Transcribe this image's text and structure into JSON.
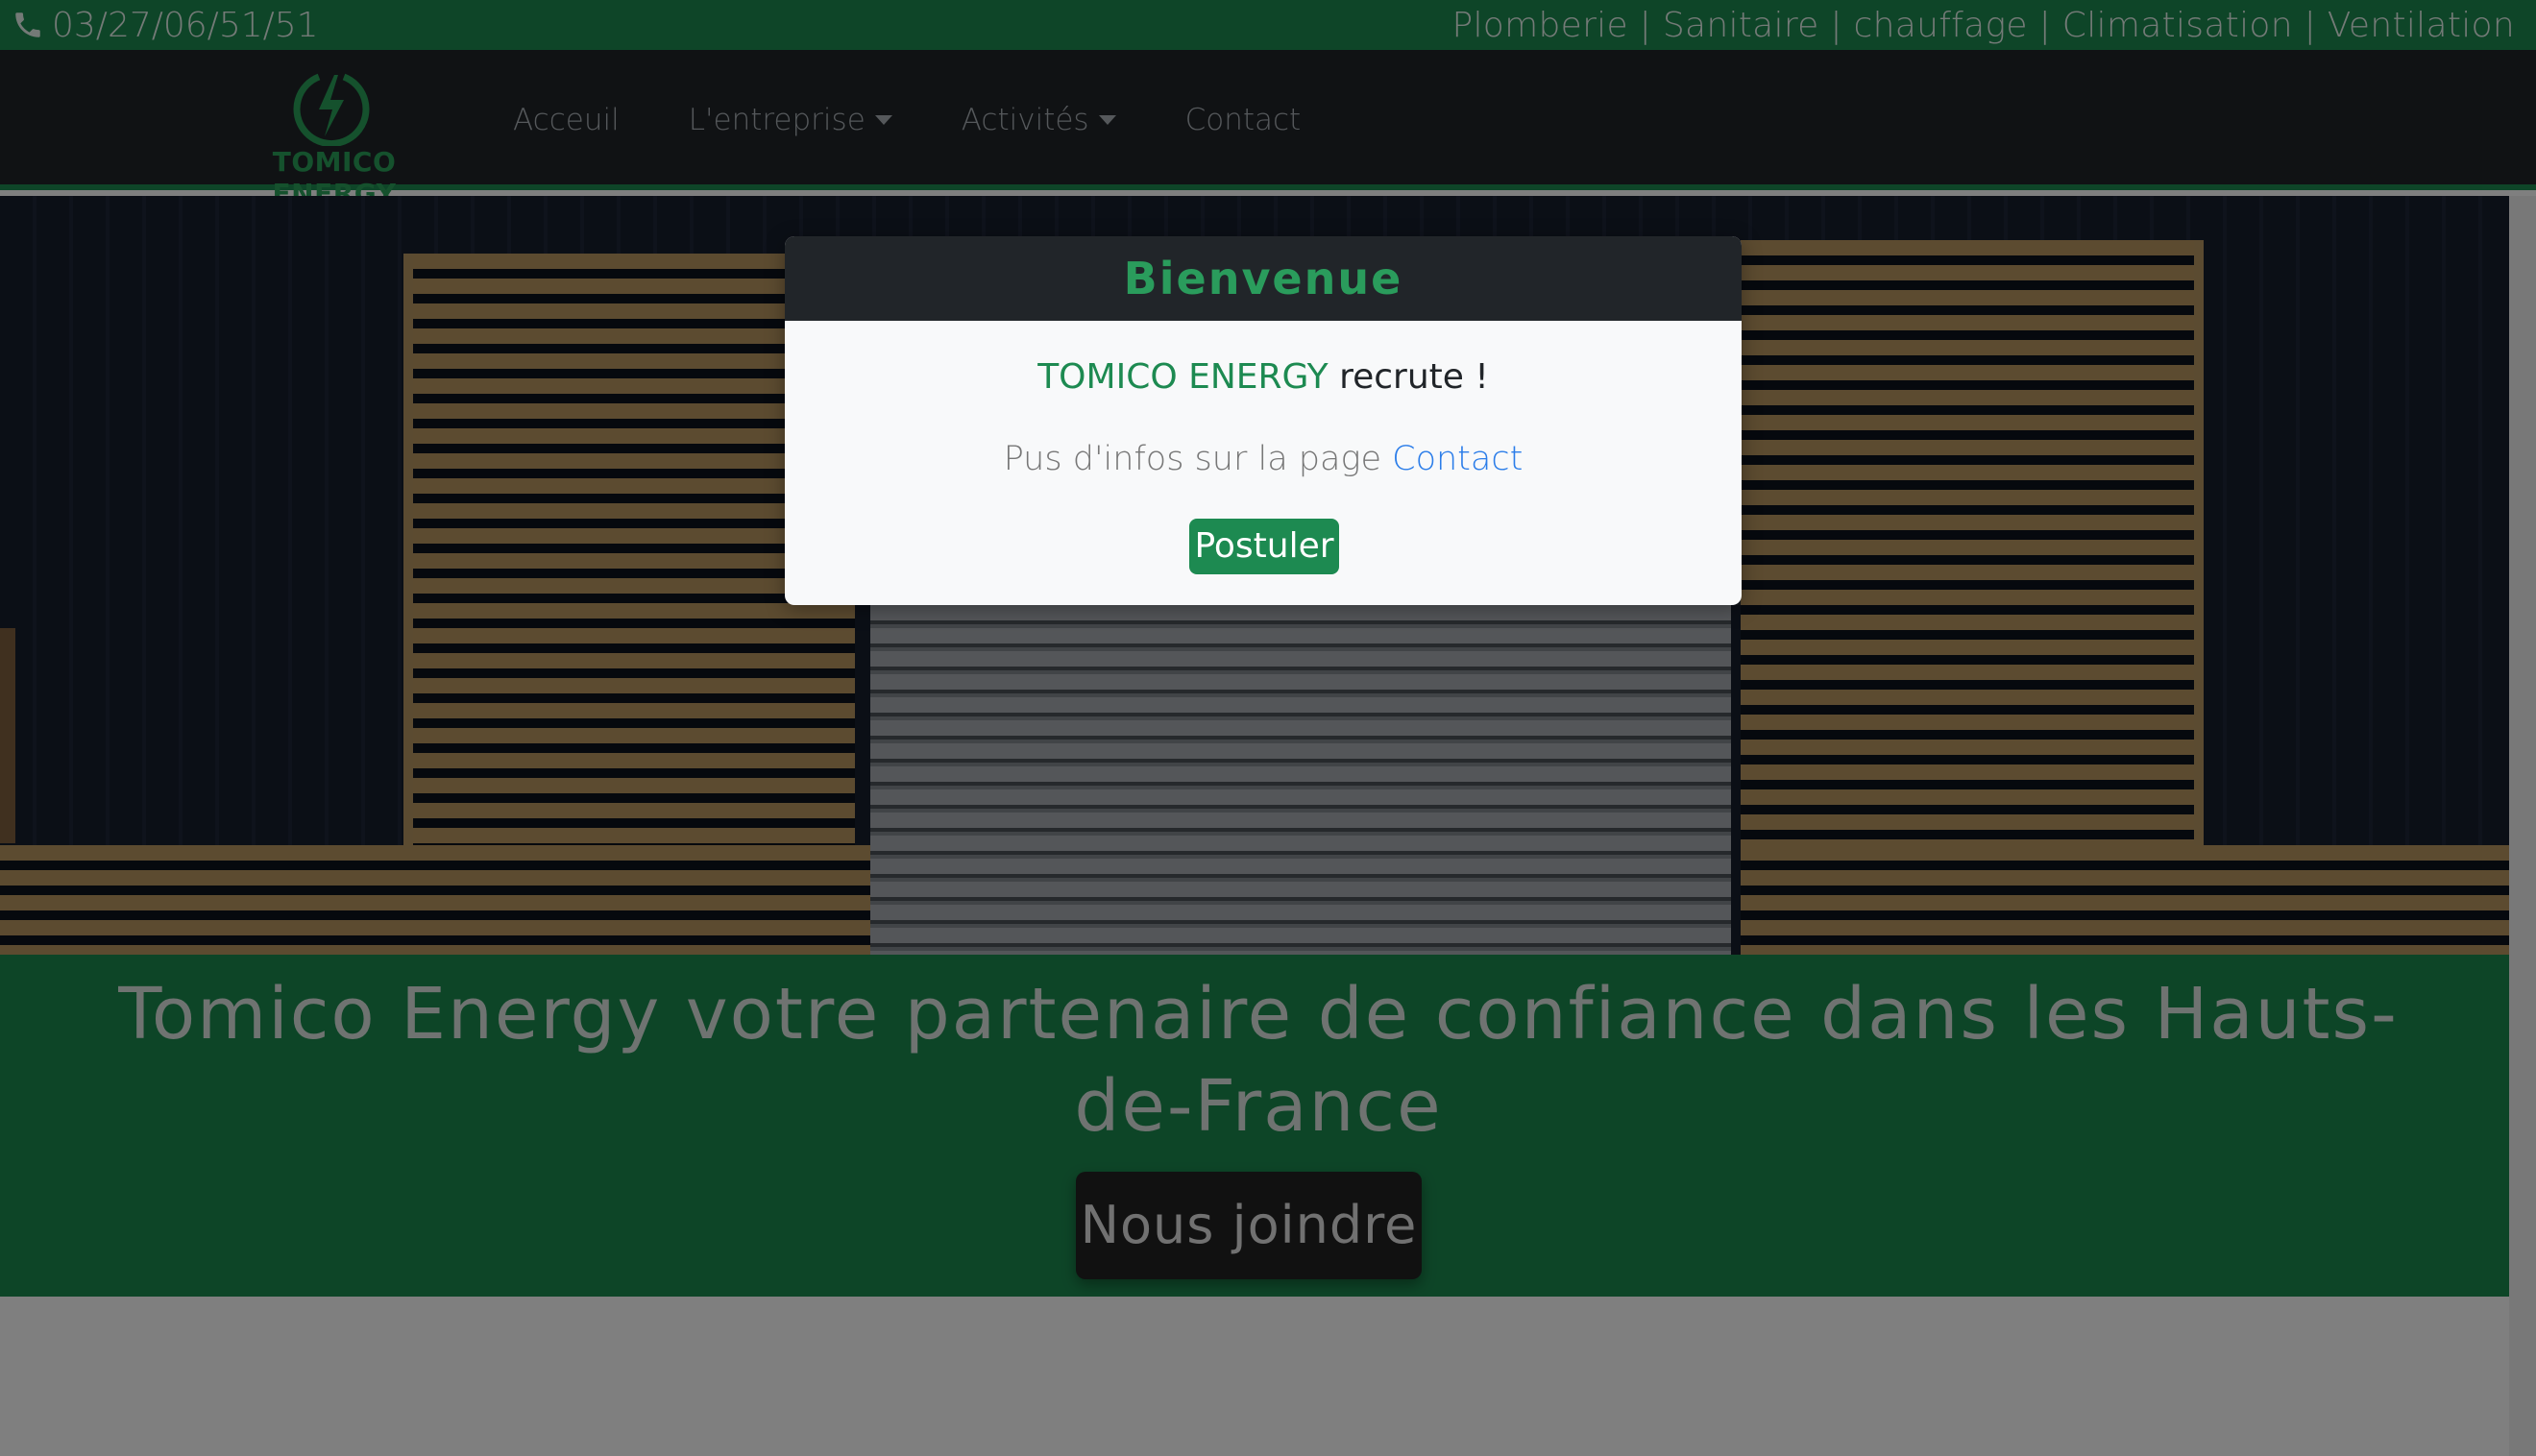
{
  "topbar": {
    "phone": "03/27/06/51/51",
    "services": "Plomberie | Sanitaire | chauffage | Climatisation | Ventilation"
  },
  "logo": {
    "name": "TOMICO ENERGY"
  },
  "nav": {
    "items": [
      {
        "label": "Acceuil"
      },
      {
        "label": "L'entreprise"
      },
      {
        "label": "Activités"
      },
      {
        "label": "Contact"
      }
    ]
  },
  "hero": {
    "title": "Tomico Energy votre partenaire de confiance dans les Hauts-de-France",
    "cta": "Nous joindre"
  },
  "modal": {
    "title": "Bienvenue",
    "brand": "TOMICO ENERGY",
    "recruit": " recrute !",
    "info_prefix": "Pus d'infos sur la page ",
    "info_link": "Contact",
    "button": "Postuler"
  },
  "colors": {
    "brand_green": "#1d8a51",
    "dark": "#212529",
    "link_blue": "#2b7de9"
  }
}
